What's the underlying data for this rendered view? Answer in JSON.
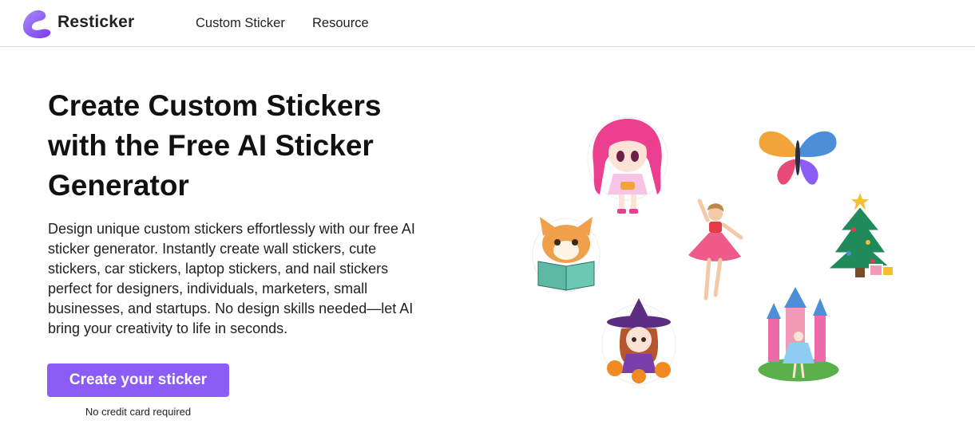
{
  "header": {
    "brand": "Resticker",
    "nav": [
      "Custom Sticker",
      "Resource"
    ]
  },
  "hero": {
    "title": "Create Custom Stickers with the Free AI Sticker Generator",
    "description": "Design unique custom stickers effortlessly with our free AI sticker generator. Instantly create wall stickers, cute stickers, car stickers, laptop stickers, and nail stickers perfect for designers, individuals, marketers, small businesses, and startups. No design skills needed—let AI bring your creativity to life in seconds.",
    "cta_label": "Create your sticker",
    "cta_note": "No credit card required"
  },
  "colors": {
    "accent": "#8b5cf6",
    "logo": "#8b5cf6"
  },
  "stickers": [
    "pink-hair-girl-sticker",
    "butterfly-sticker",
    "cat-reading-sticker",
    "dancer-sticker",
    "christmas-tree-sticker",
    "witch-girl-sticker",
    "castle-princess-sticker"
  ]
}
